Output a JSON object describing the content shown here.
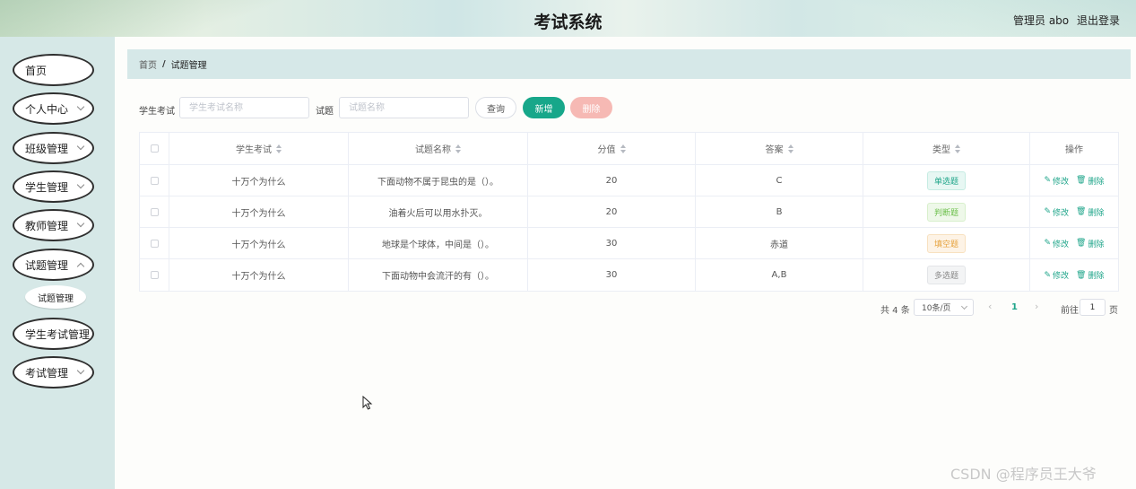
{
  "header": {
    "title": "考试系统",
    "user": "管理员 abo",
    "logout": "退出登录"
  },
  "sidebar": {
    "items": [
      {
        "label": "首页",
        "has_arrow": false
      },
      {
        "label": "个人中心",
        "has_arrow": true
      },
      {
        "label": "班级管理",
        "has_arrow": true
      },
      {
        "label": "学生管理",
        "has_arrow": true
      },
      {
        "label": "教师管理",
        "has_arrow": true
      },
      {
        "label": "试题管理",
        "has_arrow": true
      },
      {
        "label": "学生考试管理",
        "has_arrow": false
      },
      {
        "label": "考试管理",
        "has_arrow": true
      }
    ],
    "submenu": {
      "label": "试题管理"
    }
  },
  "breadcrumb": {
    "home": "首页",
    "separator": "/",
    "current": "试题管理"
  },
  "search": {
    "exam_label": "学生考试",
    "exam_placeholder": "学生考试名称",
    "question_label": "试题",
    "question_placeholder": "试题名称",
    "query_button": "查询",
    "add_button": "新增",
    "delete_button": "删除"
  },
  "table": {
    "columns": [
      "学生考试",
      "试题名称",
      "分值",
      "答案",
      "类型",
      "操作"
    ],
    "rows": [
      {
        "exam": "十万个为什么",
        "question": "下面动物不属于昆虫的是（）。",
        "score": "20",
        "answer": "C",
        "type": "单选题"
      },
      {
        "exam": "十万个为什么",
        "question": "油着火后可以用水扑灭。",
        "score": "20",
        "answer": "B",
        "type": "判断题"
      },
      {
        "exam": "十万个为什么",
        "question": "地球是个球体，中间是（）。",
        "score": "30",
        "answer": "赤道",
        "type": "填空题"
      },
      {
        "exam": "十万个为什么",
        "question": "下面动物中会流汗的有（）。",
        "score": "30",
        "answer": "A,B",
        "type": "多选题"
      }
    ],
    "edit_label": "修改",
    "delete_label": "删除"
  },
  "pagination": {
    "total": "共 4 条",
    "page_size": "10条/页",
    "current_page": "1",
    "goto_label": "前往",
    "goto_value": "1",
    "page_suffix": "页"
  },
  "watermark": "CSDN @程序员王大爷",
  "colors": {
    "accent": "#17a78a",
    "danger_light": "#f6b9b4",
    "sidebar_bg": "#d6e8e7"
  }
}
